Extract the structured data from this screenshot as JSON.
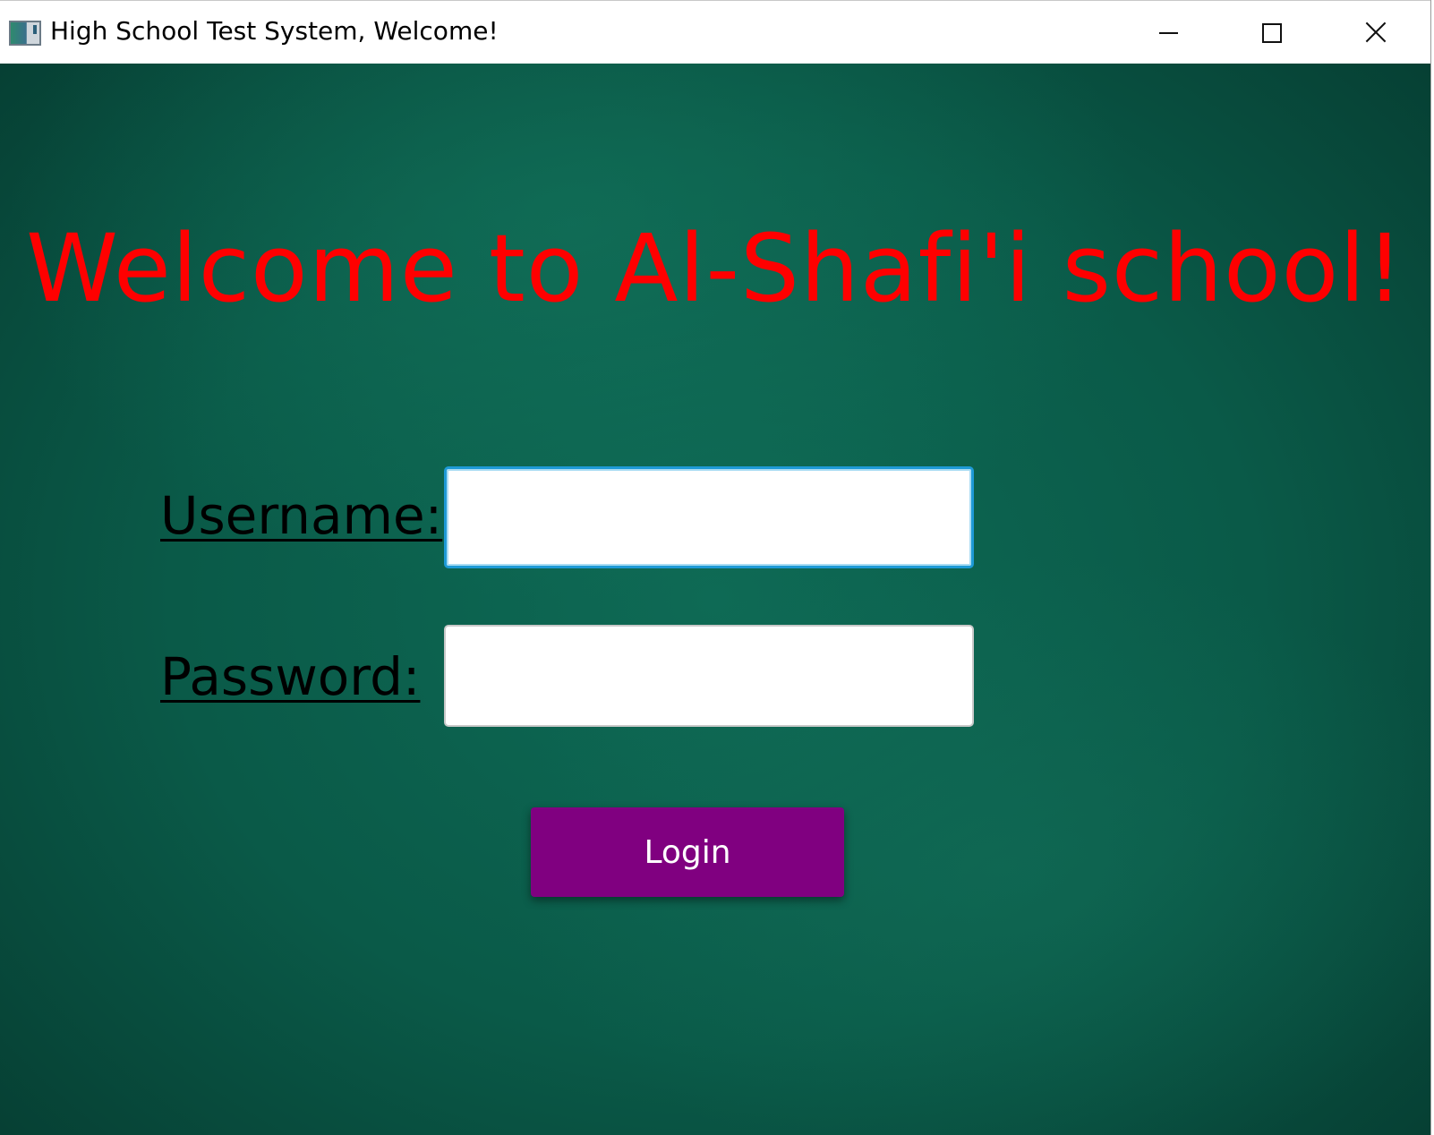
{
  "window": {
    "title": "High School Test System, Welcome!",
    "controls": {
      "minimize_icon": "minimize-icon",
      "maximize_icon": "maximize-icon",
      "close_icon": "close-icon"
    }
  },
  "main": {
    "headline": "Welcome to Al-Shafi'i school!",
    "username_label": "Username:",
    "username_value": "",
    "password_label": "Password:",
    "password_value": "",
    "login_label": "Login"
  },
  "colors": {
    "background": "#0b5d4a",
    "headline": "#ff0000",
    "login_button": "#800080",
    "focus_border": "#1e9ad6"
  }
}
